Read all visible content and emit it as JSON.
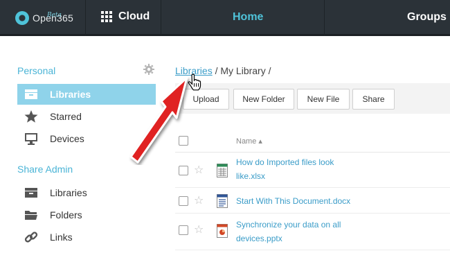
{
  "topbar": {
    "logo_text": "Open365",
    "logo_badge": "Beta",
    "cloud_label": "Cloud",
    "nav_home": "Home",
    "nav_groups": "Groups"
  },
  "sidebar": {
    "personal_heading": "Personal",
    "personal_items": [
      {
        "label": "Libraries",
        "icon": "library-icon",
        "active": true
      },
      {
        "label": "Starred",
        "icon": "star-icon"
      },
      {
        "label": "Devices",
        "icon": "monitor-icon"
      }
    ],
    "share_admin_heading": "Share Admin",
    "share_items": [
      {
        "label": "Libraries",
        "icon": "library-icon"
      },
      {
        "label": "Folders",
        "icon": "folder-icon"
      },
      {
        "label": "Links",
        "icon": "link-icon"
      }
    ]
  },
  "breadcrumb": {
    "root": "Libraries",
    "rest": " / My Library /"
  },
  "toolbar": {
    "upload": "Upload",
    "new_folder": "New Folder",
    "new_file": "New File",
    "share": "Share"
  },
  "table": {
    "name_header": "Name ▴",
    "files": [
      {
        "line1": "How do Imported files look",
        "line2": "like.xlsx",
        "type": "spreadsheet-icon"
      },
      {
        "line1": "Start With This Document.docx",
        "line2": "",
        "type": "document-icon"
      },
      {
        "line1": "Synchronize your data on all",
        "line2": "devices.pptx",
        "type": "presentation-icon"
      }
    ]
  },
  "colors": {
    "topbar": "#2b3238",
    "accent": "#4fc3d9",
    "active_item": "#8fd3ea",
    "link": "#3a9cc8",
    "arrow": "#e02020"
  }
}
